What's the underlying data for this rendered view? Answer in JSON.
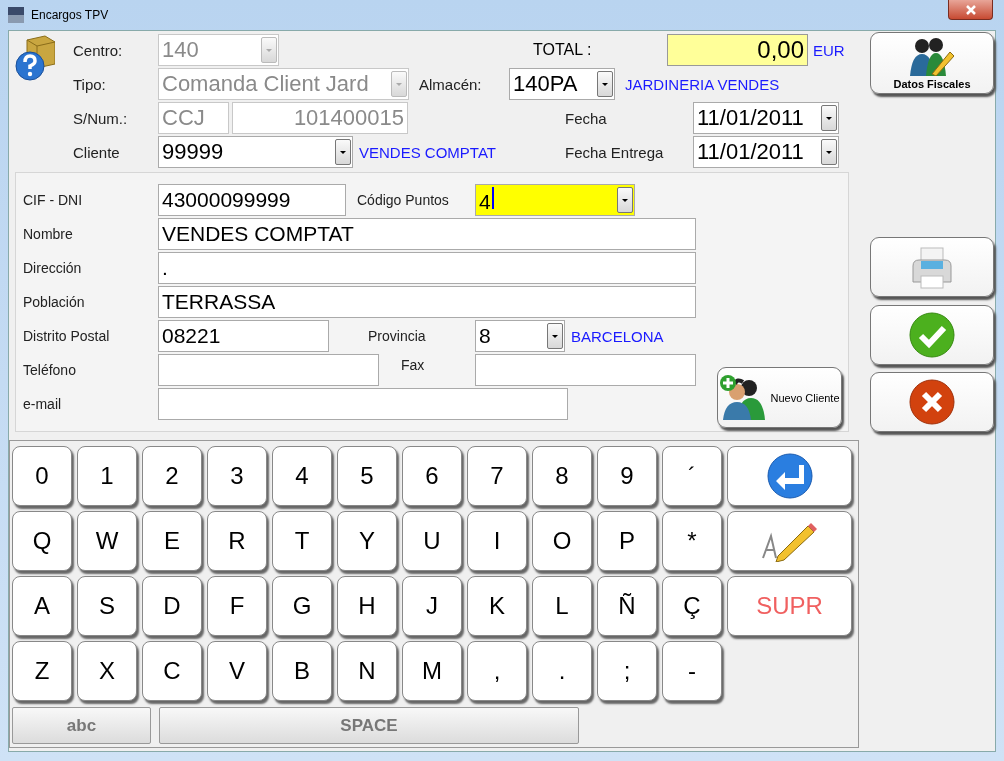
{
  "window": {
    "title": "Encargos TPV"
  },
  "centro": {
    "label": "Centro:",
    "value": "140",
    "disabled": true
  },
  "total": {
    "label": "TOTAL :",
    "value": "0,00",
    "currency": "EUR"
  },
  "tipo": {
    "label": "Tipo:",
    "value": "Comanda Client Jard",
    "disabled": true
  },
  "almacen": {
    "label": "Almacén:",
    "value": "140PA",
    "name": "JARDINERIA VENDES"
  },
  "snum": {
    "label": "S/Num.:",
    "series": "CCJ",
    "number": "101400015",
    "disabled": true
  },
  "fecha": {
    "label": "Fecha",
    "value": "11/01/2011"
  },
  "cliente": {
    "label": "Cliente",
    "value": "99999",
    "name": "VENDES COMPTAT"
  },
  "fecha_entrega": {
    "label": "Fecha Entrega",
    "value": "11/01/2011"
  },
  "datos_fiscales_button": {
    "label": "Datos Fiscales"
  },
  "client_form": {
    "cif": {
      "label": "CIF - DNI",
      "value": "43000099999"
    },
    "codigo_puntos": {
      "label": "Código Puntos",
      "value": "4"
    },
    "nombre": {
      "label": "Nombre",
      "value": "VENDES COMPTAT"
    },
    "direccion": {
      "label": "Dirección",
      "value": "."
    },
    "poblacion": {
      "label": "Población",
      "value": "TERRASSA"
    },
    "distrito_postal": {
      "label": "Distrito Postal",
      "value": "08221"
    },
    "provincia": {
      "label": "Provincia",
      "value": "8",
      "name": "BARCELONA"
    },
    "telefono": {
      "label": "Teléfono"
    },
    "fax": {
      "label": "Fax"
    },
    "email": {
      "label": "e-mail"
    }
  },
  "nuevo_cliente_button": {
    "label": "Nuevo Cliente"
  },
  "keyboard": {
    "rows": [
      [
        {
          "kind": "char",
          "label": "0"
        },
        {
          "kind": "char",
          "label": "1"
        },
        {
          "kind": "char",
          "label": "2"
        },
        {
          "kind": "char",
          "label": "3"
        },
        {
          "kind": "char",
          "label": "4"
        },
        {
          "kind": "char",
          "label": "5"
        },
        {
          "kind": "char",
          "label": "6"
        },
        {
          "kind": "char",
          "label": "7"
        },
        {
          "kind": "char",
          "label": "8"
        },
        {
          "kind": "char",
          "label": "9"
        },
        {
          "kind": "char",
          "label": "´"
        },
        {
          "kind": "enter"
        }
      ],
      [
        {
          "kind": "char",
          "label": "Q"
        },
        {
          "kind": "char",
          "label": "W"
        },
        {
          "kind": "char",
          "label": "E"
        },
        {
          "kind": "char",
          "label": "R"
        },
        {
          "kind": "char",
          "label": "T"
        },
        {
          "kind": "char",
          "label": "Y"
        },
        {
          "kind": "char",
          "label": "U"
        },
        {
          "kind": "char",
          "label": "I"
        },
        {
          "kind": "char",
          "label": "O"
        },
        {
          "kind": "char",
          "label": "P"
        },
        {
          "kind": "char",
          "label": "*"
        },
        {
          "kind": "edit"
        }
      ],
      [
        {
          "kind": "char",
          "label": "A"
        },
        {
          "kind": "char",
          "label": "S"
        },
        {
          "kind": "char",
          "label": "D"
        },
        {
          "kind": "char",
          "label": "F"
        },
        {
          "kind": "char",
          "label": "G"
        },
        {
          "kind": "char",
          "label": "H"
        },
        {
          "kind": "char",
          "label": "J"
        },
        {
          "kind": "char",
          "label": "K"
        },
        {
          "kind": "char",
          "label": "L"
        },
        {
          "kind": "char",
          "label": "Ñ"
        },
        {
          "kind": "char",
          "label": "Ç"
        },
        {
          "kind": "delete",
          "label": "SUPR"
        }
      ],
      [
        {
          "kind": "char",
          "label": "Z"
        },
        {
          "kind": "char",
          "label": "X"
        },
        {
          "kind": "char",
          "label": "C"
        },
        {
          "kind": "char",
          "label": "V"
        },
        {
          "kind": "char",
          "label": "B"
        },
        {
          "kind": "char",
          "label": "N"
        },
        {
          "kind": "char",
          "label": "M"
        },
        {
          "kind": "char",
          "label": ","
        },
        {
          "kind": "char",
          "label": "."
        },
        {
          "kind": "char",
          "label": ";"
        },
        {
          "kind": "char",
          "label": "-"
        }
      ]
    ],
    "bottom": [
      {
        "kind": "mode",
        "label": "abc"
      },
      {
        "kind": "space",
        "label": "SPACE"
      }
    ]
  }
}
